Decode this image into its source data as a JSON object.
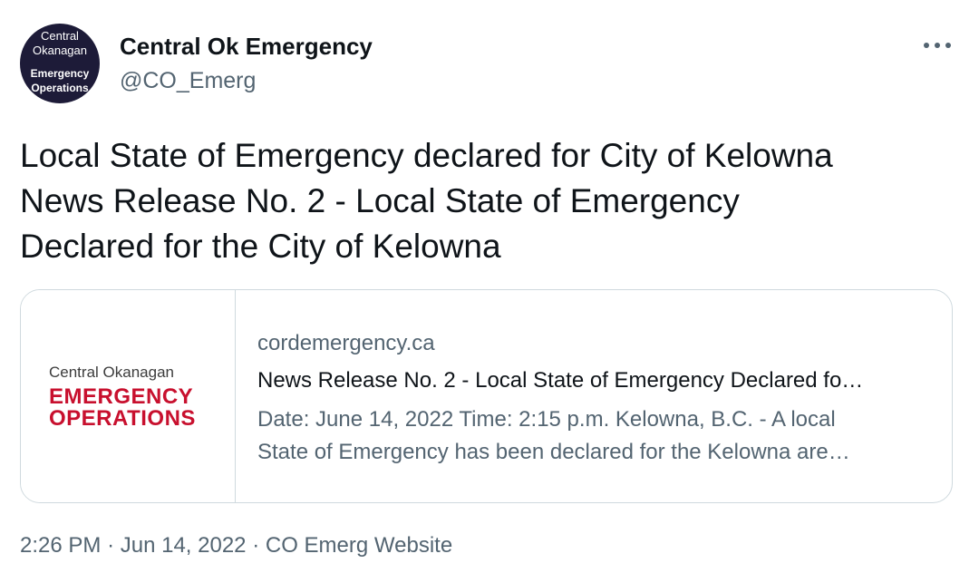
{
  "author": {
    "avatar_lines": [
      "Central",
      "Okanagan",
      "Emergency",
      "Operations"
    ],
    "display_name": "Central Ok Emergency",
    "handle": "@CO_Emerg"
  },
  "more_icon": "more-horizontal-icon",
  "tweet_text_lines": [
    "Local State of Emergency declared for City of Kelowna",
    "News Release No. 2 - Local State of Emergency",
    "Declared for the City of Kelowna"
  ],
  "card": {
    "logo": {
      "subtitle": "Central Okanagan",
      "line1": "EMERGENCY",
      "line2": "OPERATIONS",
      "color": "#c8102e"
    },
    "domain": "cordemergency.ca",
    "title": "News Release No. 2 - Local State of Emergency Declared fo…",
    "description_lines": [
      "Date: June 14, 2022  Time: 2:15 p.m.  Kelowna, B.C. - A local",
      "State of Emergency has been declared for the Kelowna are…"
    ]
  },
  "meta": {
    "time": "2:26 PM",
    "separator": "·",
    "date": "Jun 14, 2022",
    "source": "CO Emerg Website"
  },
  "colors": {
    "text": "#0f1419",
    "secondary": "#536471",
    "border": "#cfd9de",
    "avatar_bg": "#1d1b38"
  }
}
